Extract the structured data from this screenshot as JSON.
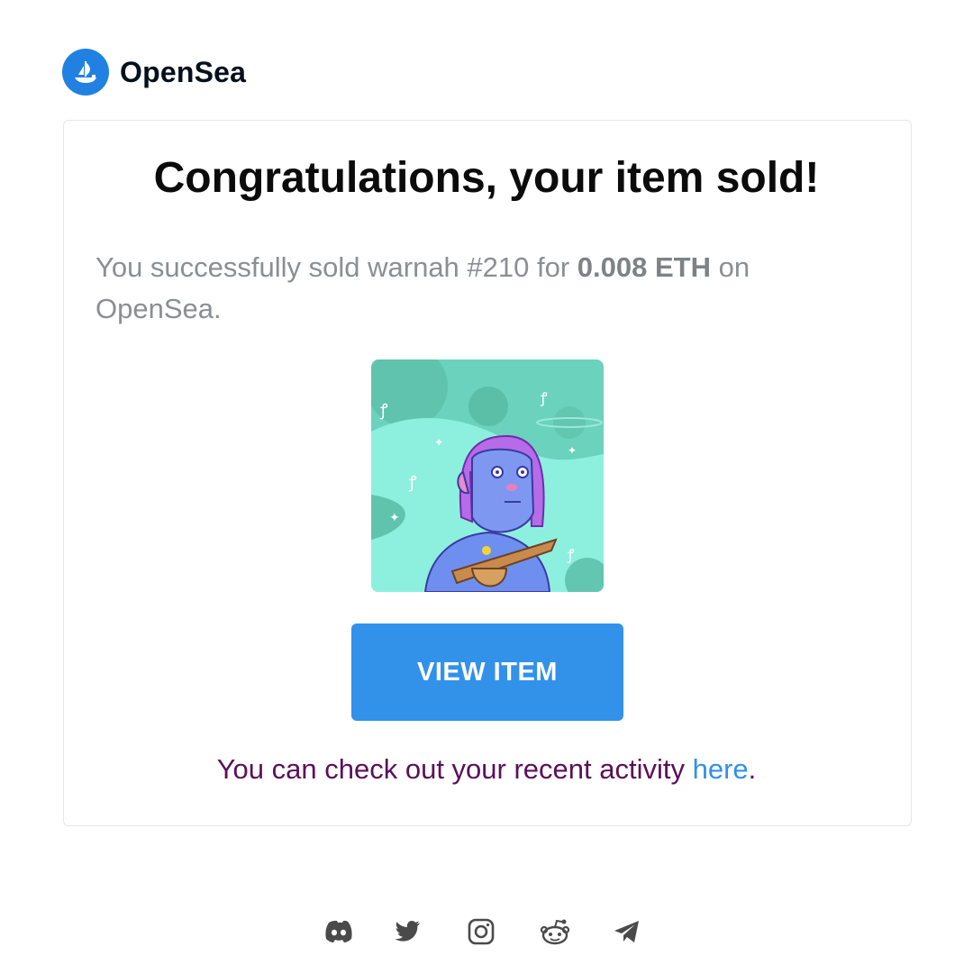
{
  "brand": {
    "name": "OpenSea",
    "logo_icon": "opensea-boat-icon",
    "logo_color": "#2081e2"
  },
  "card": {
    "headline": "Congratulations, your item sold!",
    "message": {
      "prefix": "You successfully sold warnah #210 for ",
      "price": "0.008 ETH",
      "suffix": " on OpenSea."
    },
    "item_image_icon": "nft-avatar-image",
    "view_button_label": "VIEW ITEM",
    "view_button_color": "#3291e9",
    "activity": {
      "prefix": "You can check out your recent activity ",
      "link": "here",
      "suffix": "."
    }
  },
  "footer": {
    "social": [
      {
        "name": "discord-icon"
      },
      {
        "name": "twitter-icon"
      },
      {
        "name": "instagram-icon"
      },
      {
        "name": "reddit-icon"
      },
      {
        "name": "telegram-icon"
      }
    ]
  }
}
